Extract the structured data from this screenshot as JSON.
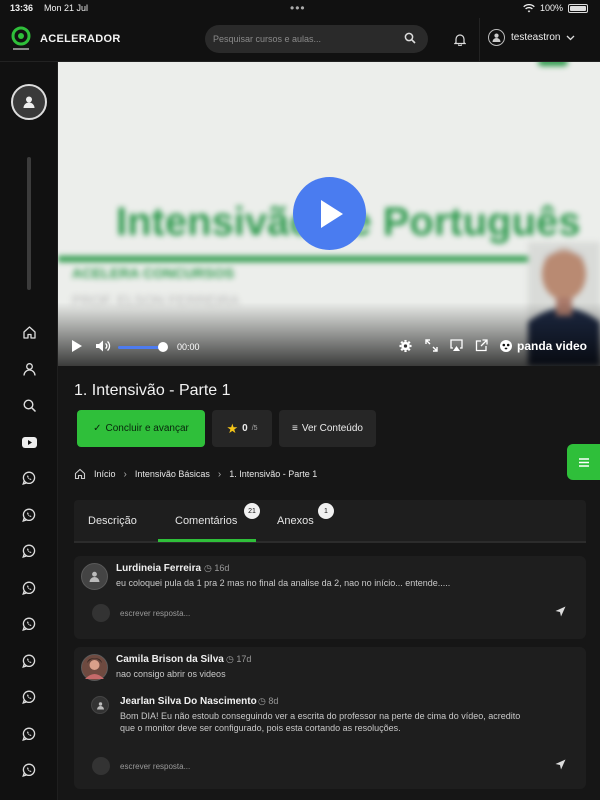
{
  "status_bar": {
    "time": "13:36",
    "date": "Mon 21 Jul",
    "battery": "100%"
  },
  "header": {
    "brand": "ACELERADOR",
    "search_placeholder": "Pesquisar cursos e aulas...",
    "username": "testeastron"
  },
  "sidebar": {
    "icons": [
      "home-icon",
      "user-icon",
      "search-icon",
      "youtube-icon",
      "whatsapp-icon",
      "whatsapp-icon",
      "whatsapp-icon",
      "whatsapp-icon",
      "whatsapp-icon",
      "whatsapp-icon",
      "whatsapp-icon",
      "whatsapp-icon",
      "whatsapp-icon"
    ]
  },
  "video": {
    "slide_title": "Intensivão de Português",
    "slide_subtitle": "ACELERA CONCURSOS",
    "slide_author": "PROF. ELSON FERREIRA",
    "time": "00:00",
    "volume_fraction": 0.85,
    "player_brand": "panda video"
  },
  "lesson": {
    "title": "1. Intensivão - Parte 1",
    "complete_label": "Concluir e avançar",
    "rating_value": "0",
    "rating_total": "/5",
    "view_content_label": "Ver Conteúdo"
  },
  "breadcrumb": {
    "home": "Início",
    "course": "Intensivão Básicas",
    "current": "1. Intensivão - Parte 1"
  },
  "tabs": [
    {
      "label": "Descrição",
      "badge": ""
    },
    {
      "label": "Comentários",
      "badge": "21"
    },
    {
      "label": "Anexos",
      "badge": "1"
    }
  ],
  "comments": [
    {
      "author": "Lurdineia Ferreira",
      "age": "16d",
      "text": "eu coloquei pula da 1 pra 2 mas no final da analise da 2, nao no início... entende.....",
      "reply_placeholder": "escrever resposta..."
    },
    {
      "author": "Camila Brison da Silva",
      "age": "17d",
      "text": "nao consigo abrir os videos",
      "reply": {
        "author": "Jearlan Silva Do Nascimento",
        "age": "8d",
        "text": "Bom DIA! Eu não estoub conseguindo ver a escrita do professor na perte de cima do vídeo, acredito que o monitor deve ser configurado, pois esta cortando as resoluções."
      },
      "reply_placeholder": "escrever resposta..."
    }
  ],
  "colors": {
    "accent": "#2fbf3a",
    "play": "#4a7cf0",
    "background": "#161616"
  }
}
